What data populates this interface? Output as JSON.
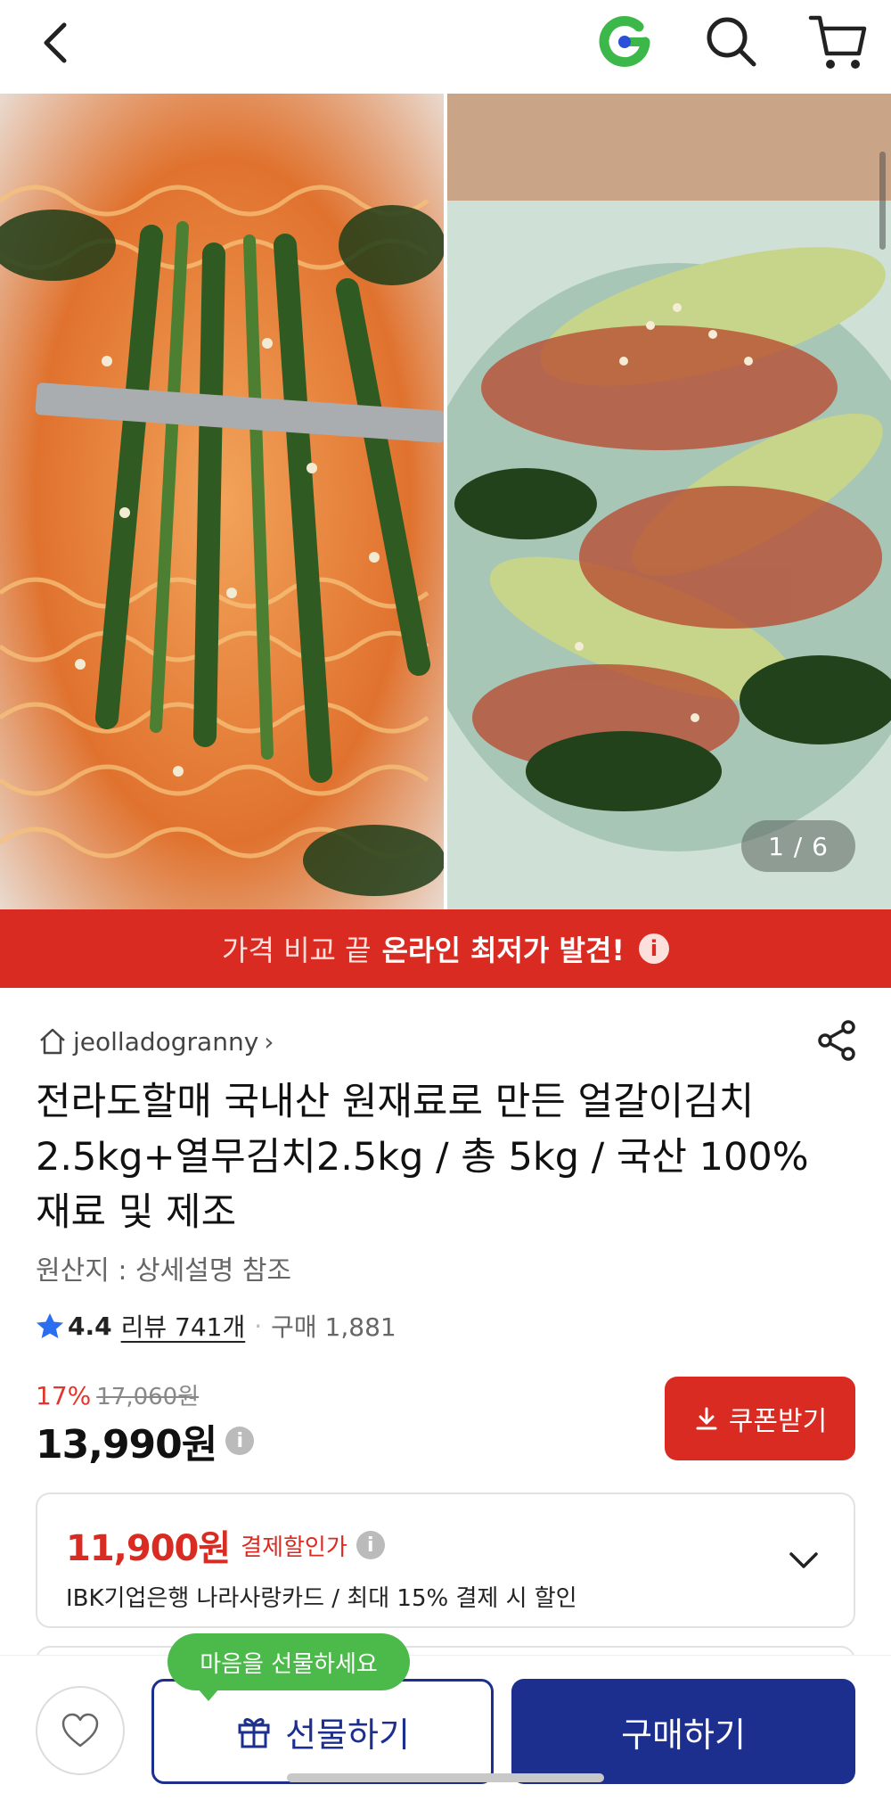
{
  "header": {
    "back_icon": "chevron-left-icon",
    "logo_icon": "gmarket-g-logo",
    "search_icon": "search-icon",
    "cart_icon": "cart-icon"
  },
  "gallery": {
    "counter": "1 / 6"
  },
  "banner": {
    "prefix": "가격 비교 끝",
    "highlight": "온라인 최저가 발견!",
    "info_icon": "i"
  },
  "product": {
    "seller": "jeolladogranny",
    "seller_chevron": "›",
    "title": "전라도할매 국내산 원재료로 만든 얼갈이김치 2.5kg+열무김치2.5kg / 총 5kg / 국산 100% 재료 및 제조",
    "origin": "원산지 : 상세설명 참조",
    "rating": "4.4",
    "reviews": "리뷰 741개",
    "dot": "·",
    "purchases": "구매 1,881",
    "discount_rate": "17%",
    "original_price": "17,060원",
    "price": "13,990원",
    "info_icon": "i"
  },
  "coupon": {
    "label": "쿠폰받기"
  },
  "card_discount": {
    "price": "11,900원",
    "label": "결제할인가",
    "info_icon": "i",
    "description": "IBK기업은행 나라사랑카드 / 최대 15% 결제 시 할인"
  },
  "bottom": {
    "tooltip": "마음을 선물하세요",
    "gift_label": "선물하기",
    "buy_label": "구매하기"
  },
  "colors": {
    "brand_red": "#d92b22",
    "brand_navy": "#1c2f8f",
    "tooltip_green": "#4cba4a",
    "star_blue": "#2a6ef2"
  }
}
